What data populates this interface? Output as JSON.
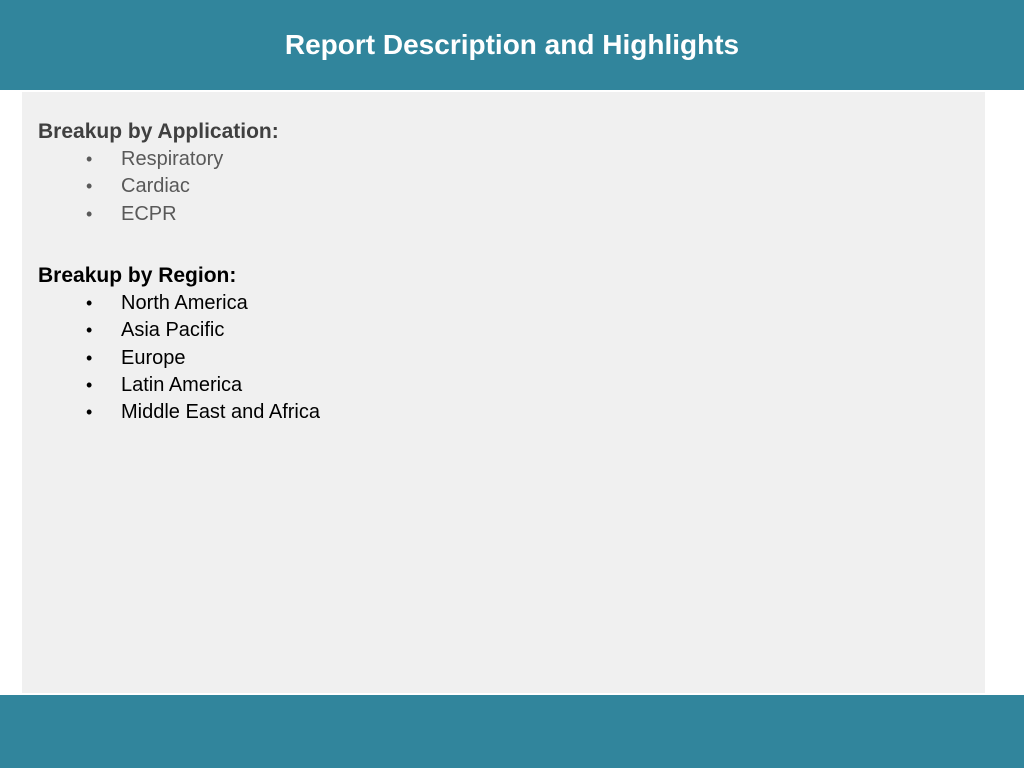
{
  "header": {
    "title": "Report Description and Highlights"
  },
  "sections": [
    {
      "heading": "Breakup by Application:",
      "items": [
        "Respiratory",
        "Cardiac",
        "ECPR"
      ]
    },
    {
      "heading": "Breakup by Region:",
      "items": [
        "North America",
        "Asia Pacific",
        "Europe",
        "Latin America",
        "Middle East and Africa"
      ]
    }
  ],
  "bullet_glyph": "•",
  "colors": {
    "header_background": "#31859c",
    "footer_background": "#31859c",
    "panel_background": "#f0f0f0",
    "title_text": "#ffffff"
  }
}
